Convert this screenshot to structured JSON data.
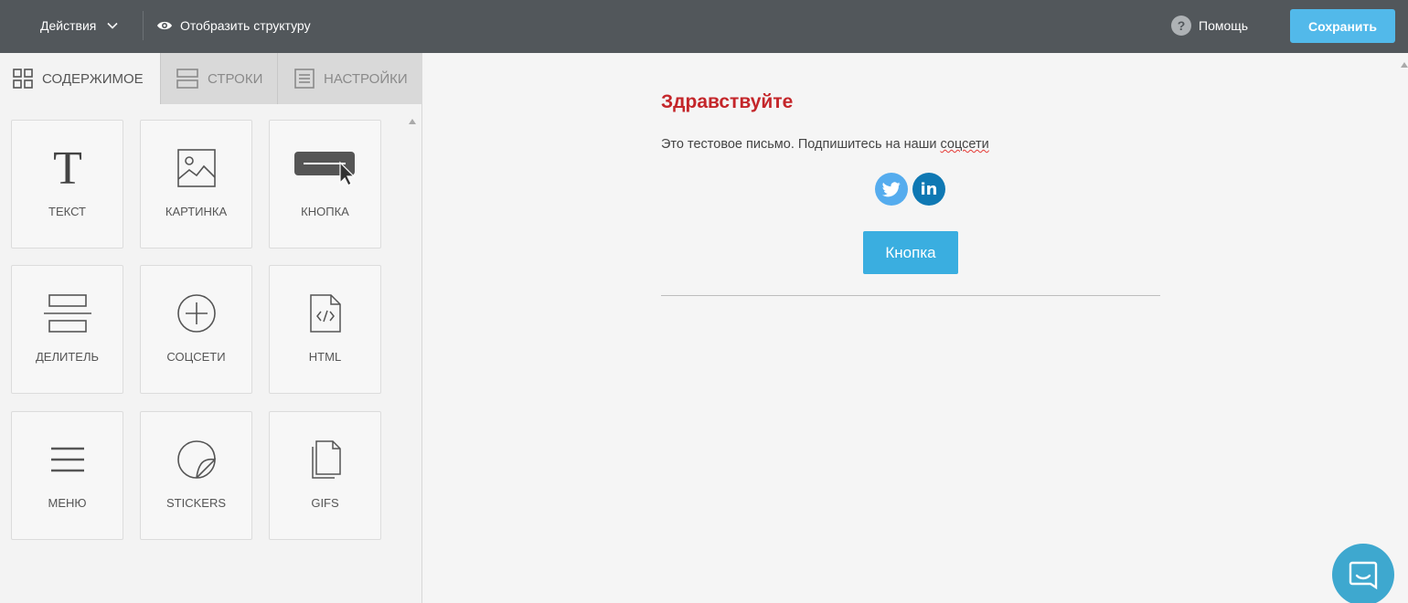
{
  "toolbar": {
    "actions_label": "Действия",
    "structure_label": "Отобразить структуру",
    "help_label": "Помощь",
    "help_glyph": "?",
    "save_label": "Сохранить"
  },
  "tabs": [
    {
      "label": "СОДЕРЖИМОЕ",
      "active": true
    },
    {
      "label": "СТРОКИ",
      "active": false
    },
    {
      "label": "НАСТРОЙКИ",
      "active": false
    }
  ],
  "blocks": [
    {
      "label": "ТЕКСТ",
      "icon": "text-icon"
    },
    {
      "label": "КАРТИНКА",
      "icon": "image-icon"
    },
    {
      "label": "КНОПКА",
      "icon": "button-icon"
    },
    {
      "label": "ДЕЛИТЕЛЬ",
      "icon": "divider-icon"
    },
    {
      "label": "СОЦСЕТИ",
      "icon": "plus-circle-icon"
    },
    {
      "label": "HTML",
      "icon": "html-file-icon"
    },
    {
      "label": "МЕНЮ",
      "icon": "menu-icon"
    },
    {
      "label": "STICKERS",
      "icon": "sticker-icon"
    },
    {
      "label": "GIFS",
      "icon": "gif-file-icon"
    }
  ],
  "email": {
    "greeting": "Здравствуйте",
    "text_before": "Это тестовое письмо. Подпишитесь на наши ",
    "text_spellcheck": "соцсети",
    "linkedin_glyph": "in",
    "button_label": "Кнопка"
  },
  "colors": {
    "topbar": "#52575b",
    "save_button": "#52b9ea",
    "greeting": "#c4262a",
    "email_button": "#3aaee0",
    "twitter": "#55acee",
    "linkedin": "#0f78b3",
    "chat": "#3ea8cf"
  }
}
